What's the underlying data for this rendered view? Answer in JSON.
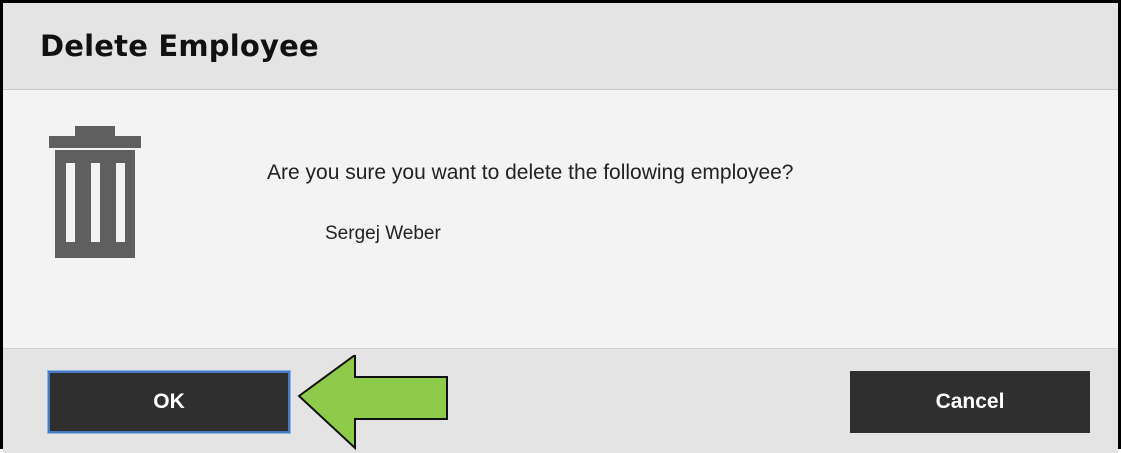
{
  "dialog": {
    "title": "Delete Employee",
    "message": "Are you sure you want to delete the following employee?",
    "employee_name": "Sergej Weber",
    "ok_label": "OK",
    "cancel_label": "Cancel"
  },
  "icons": {
    "main": "trash-icon",
    "annotation": "arrow-left-icon"
  },
  "colors": {
    "button_bg": "#2f2f2f",
    "focus_border": "#4a78c0",
    "annotation_arrow": "#8ecb4a"
  }
}
